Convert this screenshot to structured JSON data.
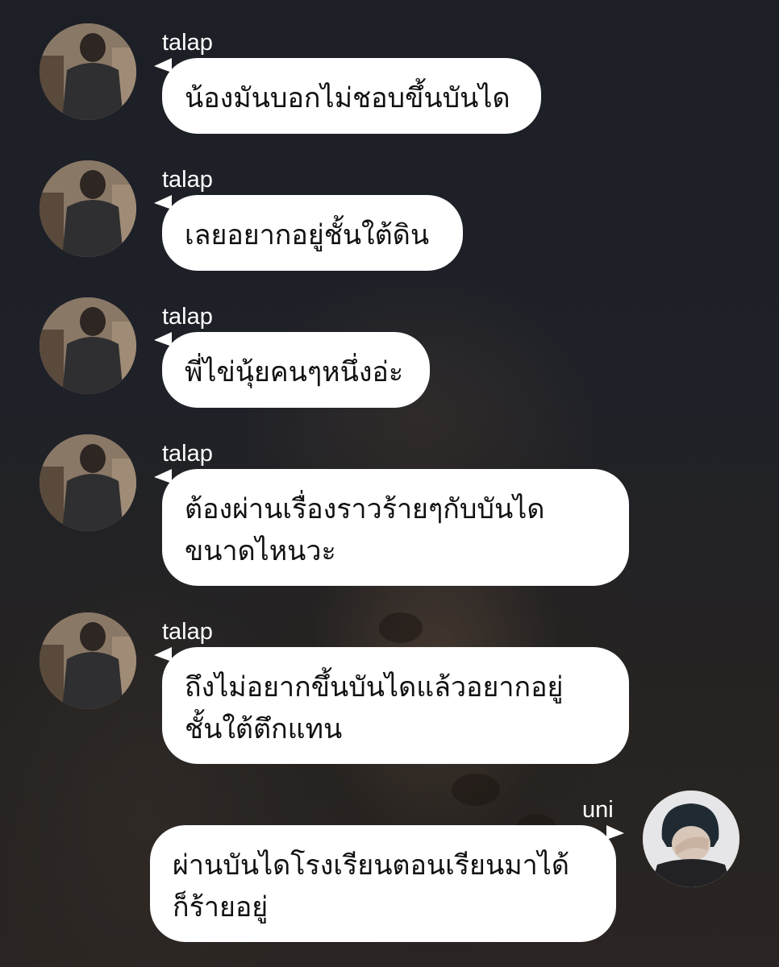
{
  "messages": [
    {
      "sender": "talap",
      "text": "น้องมันบอกไม่ชอบขึ้นบันได",
      "side": "left"
    },
    {
      "sender": "talap",
      "text": "เลยอยากอยู่ชั้นใต้ดิน",
      "side": "left"
    },
    {
      "sender": "talap",
      "text": "พี่ไข่นุ้ยคนๆหนึ่งอ่ะ",
      "side": "left"
    },
    {
      "sender": "talap",
      "text": "ต้องผ่านเรื่องราวร้ายๆกับบันได\nขนาดไหนวะ",
      "side": "left"
    },
    {
      "sender": "talap",
      "text": "ถึงไม่อยากขึ้นบันไดแล้วอยากอยู่\nชั้นใต้ตึกแทน",
      "side": "left"
    },
    {
      "sender": "uni",
      "text": "ผ่านบันไดโรงเรียนตอนเรียนมาได้\nก็ร้ายอยู่",
      "side": "right"
    }
  ],
  "colors": {
    "background": "#1d2027",
    "bubble": "#ffffff",
    "bubble_text": "#111111",
    "name_text": "#ffffff"
  }
}
